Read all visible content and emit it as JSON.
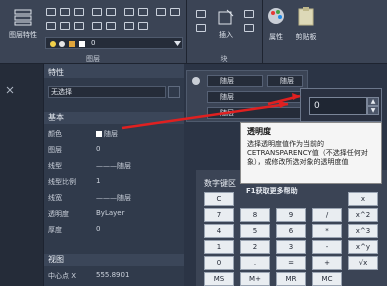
{
  "ribbon": {
    "layer_properties_label": "图层特性",
    "layer_combo_value": "0",
    "layers_panel_title": "图层",
    "block_panel_title": "块",
    "insert_label": "插入",
    "attributes_label": "属性",
    "clipboard_label": "剪贴板"
  },
  "ribbon_props": {
    "color_value": "随层",
    "color_value2": "随层",
    "linetype_value": "随层",
    "lineweight_value": "随层"
  },
  "properties_palette": {
    "title": "特性",
    "selection": "无选择",
    "sections": {
      "basic": "基本",
      "view": "视图"
    },
    "rows": [
      {
        "key": "颜色",
        "value": "随层"
      },
      {
        "key": "图层",
        "value": "0"
      },
      {
        "key": "线型",
        "value": "———随层"
      },
      {
        "key": "线型比例",
        "value": "1"
      },
      {
        "key": "线宽",
        "value": "———随层"
      },
      {
        "key": "透明度",
        "value": "ByLayer"
      },
      {
        "key": "厚度",
        "value": "0"
      }
    ],
    "view_row": {
      "key": "中心点 X",
      "value": "555.8901"
    }
  },
  "transparency_spinner": {
    "value": "0"
  },
  "tooltip": {
    "title": "透明度",
    "body": "选择透明度值作为当前的CETRANSPARENCY值（不选择任何对象），或修改所选对象的透明度值",
    "hint": "F1获取更多帮助"
  },
  "calculator": {
    "title": "数字键区",
    "keys": [
      [
        "C",
        "",
        "",
        "",
        "x"
      ],
      [
        "7",
        "8",
        "9",
        "/",
        "x^2"
      ],
      [
        "4",
        "5",
        "6",
        "*",
        "x^3"
      ],
      [
        "1",
        "2",
        "3",
        "-",
        "x^y"
      ],
      [
        "0",
        ".",
        "=",
        "+",
        "√x"
      ],
      [
        "MS",
        "M+",
        "MR",
        "MC",
        ""
      ]
    ]
  },
  "colors": {
    "accent_red": "#e02020",
    "ribbon_bg": "#3b4455",
    "panel_bg": "#303a4b"
  }
}
